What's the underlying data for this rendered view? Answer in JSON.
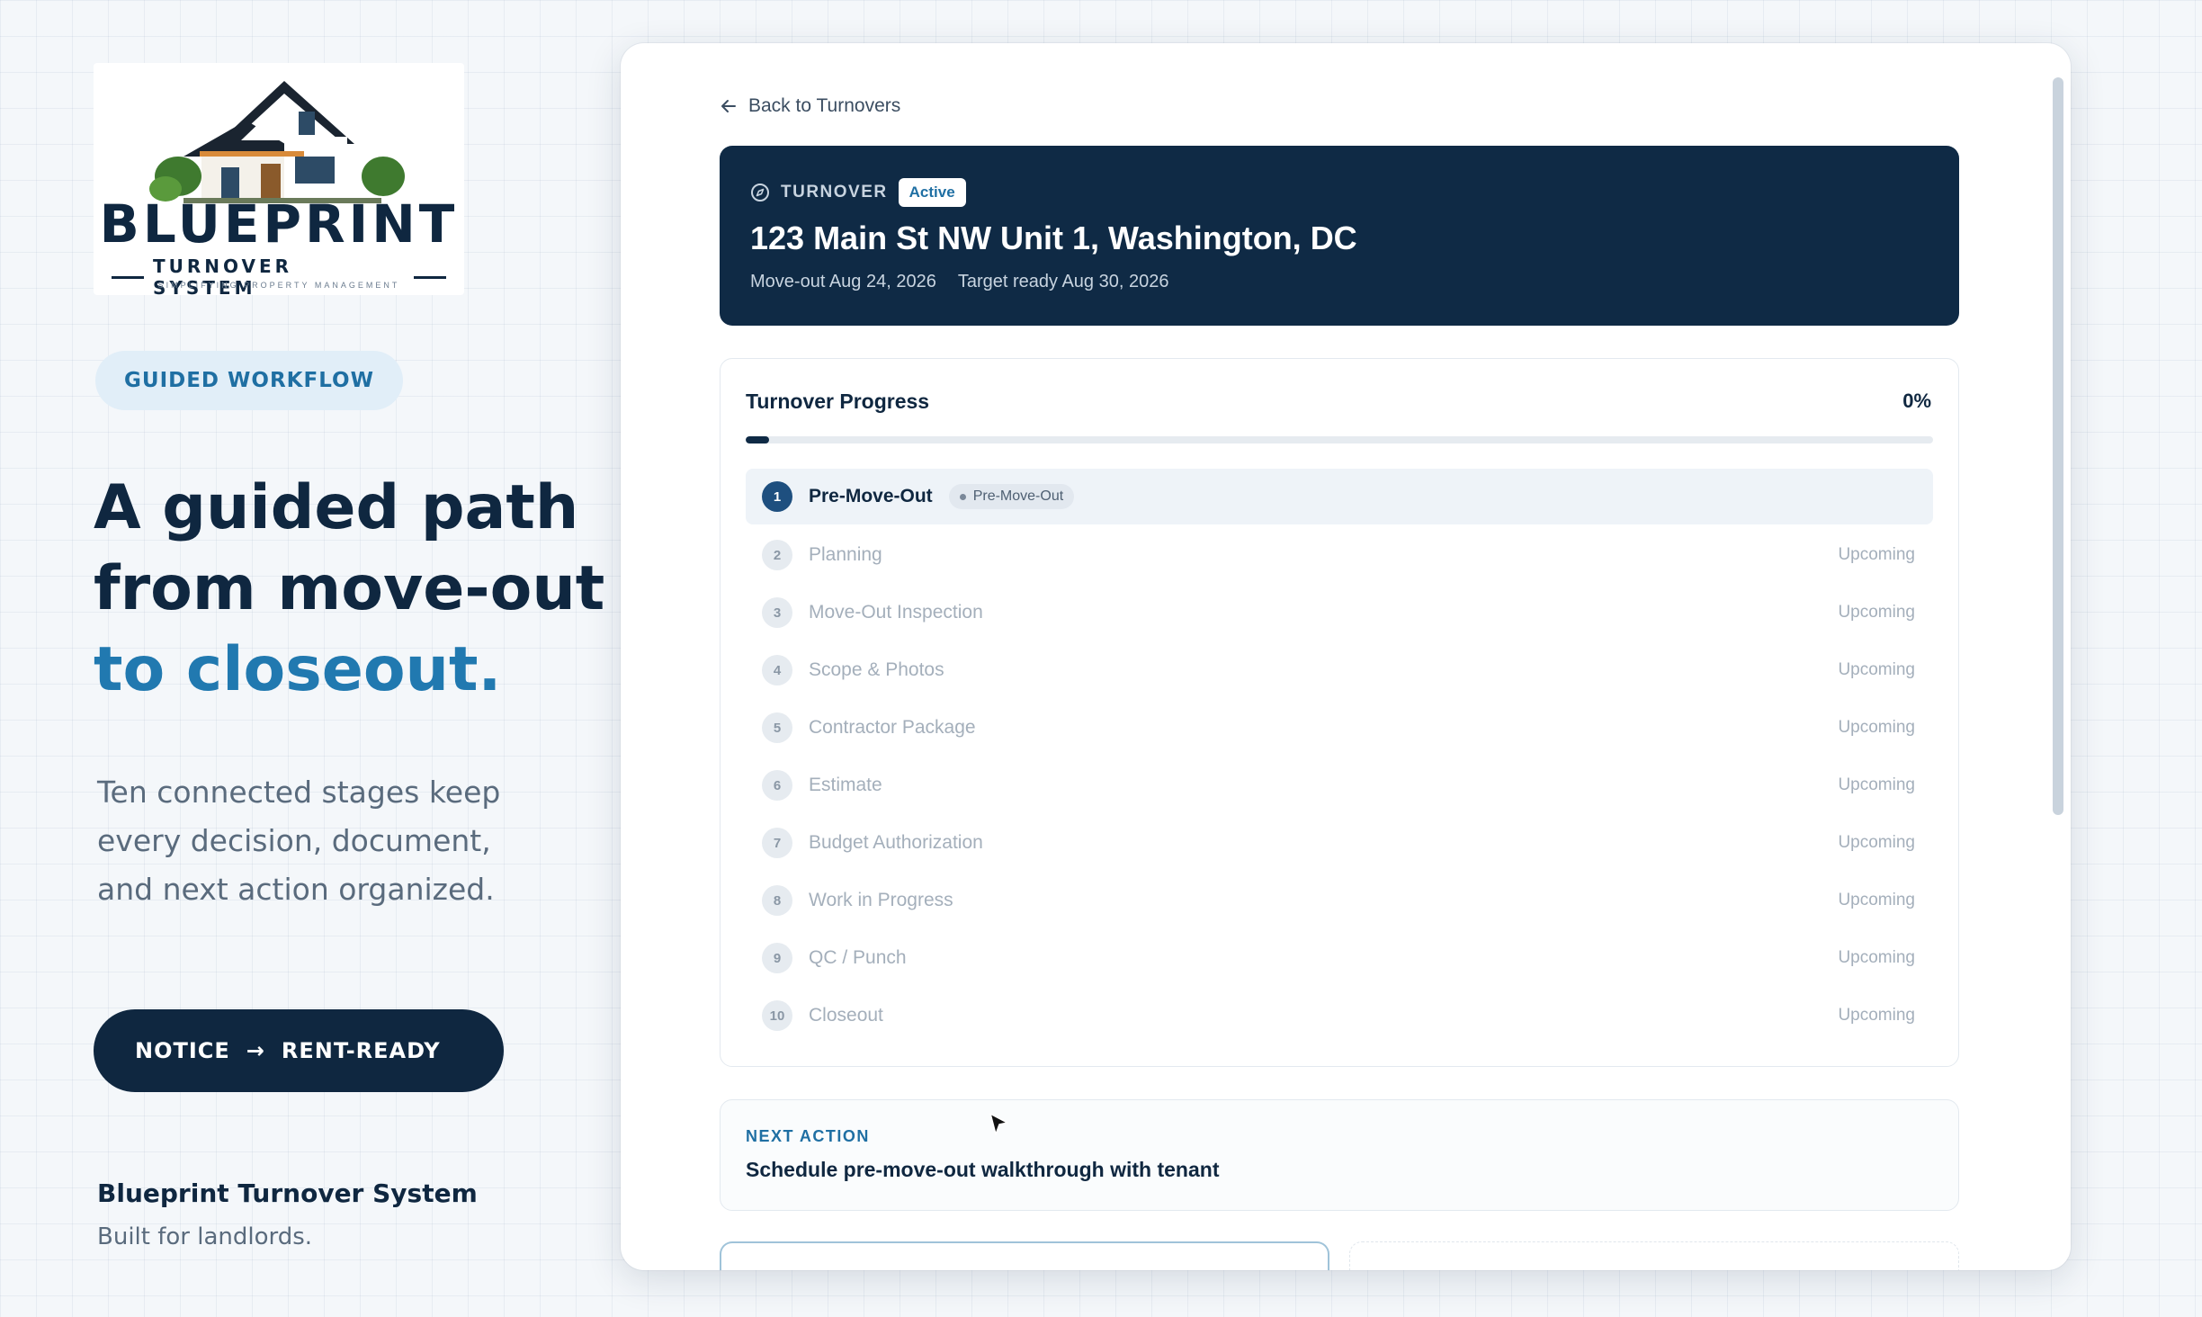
{
  "brand": {
    "logo_word": "BLUEPRINT",
    "logo_sub": "TURNOVER SYSTEM",
    "logo_tagline": "SIMPLIFYING PROPERTY MANAGEMENT",
    "footer_name": "Blueprint Turnover System",
    "footer_tag": "Built for landlords."
  },
  "marketing": {
    "chip": "GUIDED WORKFLOW",
    "headline_line1": "A guided path",
    "headline_line2": "from move-out",
    "headline_accent": "to closeout.",
    "lede_line1": "Ten connected stages keep",
    "lede_line2": "every decision, document,",
    "lede_line3": "and next action organized.",
    "cta_left": "NOTICE",
    "cta_arrow": "→",
    "cta_right": "RENT-READY"
  },
  "app": {
    "back_label": "Back to Turnovers",
    "hero": {
      "eyebrow": "TURNOVER",
      "badge": "Active",
      "address": "123 Main St NW Unit 1, Washington, DC",
      "move_out": "Move-out Aug 24, 2026",
      "target_ready": "Target ready Aug 30, 2026"
    },
    "progress": {
      "title": "Turnover Progress",
      "percent_label": "0%",
      "percent_value": 0
    },
    "stages": [
      {
        "num": "1",
        "name": "Pre-Move-Out",
        "status": "",
        "pill": "Pre-Move-Out"
      },
      {
        "num": "2",
        "name": "Planning",
        "status": "Upcoming"
      },
      {
        "num": "3",
        "name": "Move-Out Inspection",
        "status": "Upcoming"
      },
      {
        "num": "4",
        "name": "Scope & Photos",
        "status": "Upcoming"
      },
      {
        "num": "5",
        "name": "Contractor Package",
        "status": "Upcoming"
      },
      {
        "num": "6",
        "name": "Estimate",
        "status": "Upcoming"
      },
      {
        "num": "7",
        "name": "Budget Authorization",
        "status": "Upcoming"
      },
      {
        "num": "8",
        "name": "Work in Progress",
        "status": "Upcoming"
      },
      {
        "num": "9",
        "name": "QC / Punch",
        "status": "Upcoming"
      },
      {
        "num": "10",
        "name": "Closeout",
        "status": "Upcoming"
      }
    ],
    "next_action": {
      "eyebrow": "NEXT ACTION",
      "text": "Schedule pre-move-out walkthrough with tenant"
    }
  },
  "icons": {
    "back": "arrow-left-icon",
    "turnover": "compass-icon",
    "pointer": "mouse-cursor-icon"
  },
  "colors": {
    "navy": "#0f2740",
    "hero_bg": "#0f2a45",
    "accent_blue": "#2179b0",
    "chip_bg": "#e1eef8",
    "muted": "#a4afbb"
  }
}
